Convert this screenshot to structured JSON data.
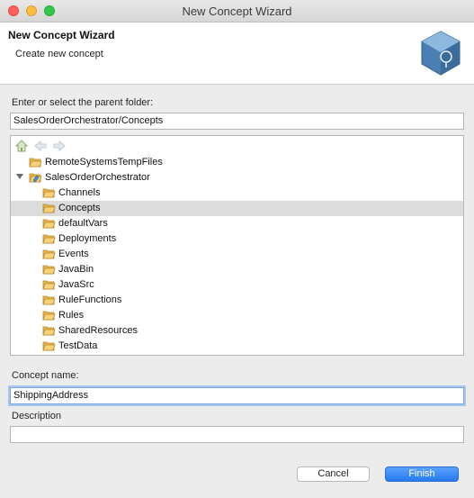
{
  "window": {
    "title": "New Concept Wizard"
  },
  "banner": {
    "title": "New Concept Wizard",
    "subtitle": "Create new concept",
    "icon": "concept-cube-icon"
  },
  "parent_folder": {
    "label": "Enter or select the parent folder:",
    "value": "SalesOrderOrchestrator/Concepts"
  },
  "tree": {
    "toolbar": [
      "home-icon",
      "back-arrow-icon",
      "forward-arrow-icon"
    ],
    "items": [
      {
        "label": "RemoteSystemsTempFiles",
        "level": 0,
        "icon": "folder-open-icon"
      },
      {
        "label": "SalesOrderOrchestrator",
        "level": 0,
        "icon": "project-icon",
        "expanded": true
      },
      {
        "label": "Channels",
        "level": 1,
        "icon": "folder-icon"
      },
      {
        "label": "Concepts",
        "level": 1,
        "icon": "folder-icon",
        "selected": true
      },
      {
        "label": "defaultVars",
        "level": 1,
        "icon": "folder-icon"
      },
      {
        "label": "Deployments",
        "level": 1,
        "icon": "folder-icon"
      },
      {
        "label": "Events",
        "level": 1,
        "icon": "folder-icon"
      },
      {
        "label": "JavaBin",
        "level": 1,
        "icon": "folder-icon"
      },
      {
        "label": "JavaSrc",
        "level": 1,
        "icon": "folder-icon"
      },
      {
        "label": "RuleFunctions",
        "level": 1,
        "icon": "folder-icon"
      },
      {
        "label": "Rules",
        "level": 1,
        "icon": "folder-icon"
      },
      {
        "label": "SharedResources",
        "level": 1,
        "icon": "folder-icon"
      },
      {
        "label": "TestData",
        "level": 1,
        "icon": "folder-icon"
      }
    ]
  },
  "concept_name": {
    "label": "Concept name:",
    "value": "ShippingAddress"
  },
  "description": {
    "label": "Description",
    "value": ""
  },
  "buttons": {
    "cancel": "Cancel",
    "finish": "Finish"
  },
  "colors": {
    "accent": "#2779f1",
    "selection": "#dcdcdc",
    "folder": "#f0c040"
  }
}
